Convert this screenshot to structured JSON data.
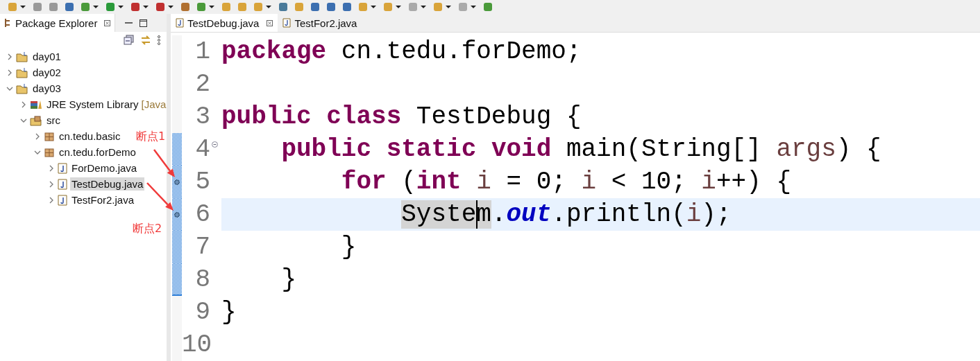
{
  "explorer": {
    "title": "Package Explorer",
    "tree": [
      {
        "label": "day01",
        "kind": "project",
        "expanded": false,
        "selected": false
      },
      {
        "label": "day02",
        "kind": "project",
        "expanded": false,
        "selected": false
      },
      {
        "label": "day03",
        "kind": "project",
        "expanded": true,
        "selected": false,
        "children": [
          {
            "label": "JRE System Library",
            "decoration": "[Java",
            "kind": "library",
            "expanded": false,
            "selected": false
          },
          {
            "label": "src",
            "kind": "source",
            "expanded": true,
            "selected": false,
            "children": [
              {
                "label": "cn.tedu.basic",
                "kind": "package",
                "expanded": false,
                "selected": false
              },
              {
                "label": "cn.tedu.forDemo",
                "kind": "package",
                "expanded": true,
                "selected": false,
                "children": [
                  {
                    "label": "ForDemo.java",
                    "kind": "file",
                    "expanded": false,
                    "selected": false
                  },
                  {
                    "label": "TestDebug.java",
                    "kind": "file",
                    "expanded": false,
                    "selected": true
                  },
                  {
                    "label": "TestFor2.java",
                    "kind": "file",
                    "expanded": false,
                    "selected": false
                  }
                ]
              }
            ]
          }
        ]
      }
    ]
  },
  "editor": {
    "tabs": [
      {
        "label": "TestDebug.java",
        "selected": true
      },
      {
        "label": "TestFor2.java",
        "selected": false
      }
    ],
    "lines": [
      {
        "number": "1",
        "tokens": [
          {
            "text": "package",
            "kind": "keyword"
          },
          {
            "text": " cn.tedu.forDemo;",
            "kind": "plain"
          }
        ]
      },
      {
        "number": "2"
      },
      {
        "number": "3",
        "tokens": [
          {
            "text": "public",
            "kind": "keyword"
          },
          {
            "text": " class",
            "kind": "keyword"
          },
          {
            "text": " TestDebug {",
            "kind": "plain"
          }
        ]
      },
      {
        "number": "4",
        "range": true,
        "foldable": true,
        "tokens": [
          {
            "text": "    public",
            "kind": "keyword"
          },
          {
            "text": " static",
            "kind": "keyword"
          },
          {
            "text": " void",
            "kind": "keyword"
          },
          {
            "text": " main(String[] ",
            "kind": "plain"
          },
          {
            "text": "args",
            "kind": "variable"
          },
          {
            "text": ") {",
            "kind": "plain"
          }
        ]
      },
      {
        "number": "5",
        "range": true,
        "breakpoint": true,
        "tokens": [
          {
            "text": "        for",
            "kind": "keyword"
          },
          {
            "text": " (",
            "kind": "plain"
          },
          {
            "text": "int",
            "kind": "keyword"
          },
          {
            "text": " i",
            "kind": "variable"
          },
          {
            "text": " = 0; ",
            "kind": "plain"
          },
          {
            "text": "i",
            "kind": "variable"
          },
          {
            "text": " < 10; ",
            "kind": "plain"
          },
          {
            "text": "i",
            "kind": "variable"
          },
          {
            "text": "++) {",
            "kind": "plain"
          }
        ]
      },
      {
        "number": "6",
        "range": true,
        "breakpoint": true,
        "current": true,
        "tokens": [
          {
            "text": "            Syste",
            "kind": "plain",
            "marked": true
          },
          {
            "text": "m",
            "kind": "plain",
            "marked": true,
            "caret_before": true
          },
          {
            "text": ".",
            "kind": "plain"
          },
          {
            "text": "out",
            "kind": "field"
          },
          {
            "text": ".println(",
            "kind": "plain"
          },
          {
            "text": "i",
            "kind": "variable"
          },
          {
            "text": ");",
            "kind": "plain"
          }
        ]
      },
      {
        "number": "7",
        "range": true,
        "tokens": [
          {
            "text": "        }",
            "kind": "plain"
          }
        ]
      },
      {
        "number": "8",
        "range": true,
        "tokens": [
          {
            "text": "    }",
            "kind": "plain"
          }
        ]
      },
      {
        "number": "9",
        "tokens": [
          {
            "text": "}",
            "kind": "plain"
          }
        ]
      },
      {
        "number": "10"
      }
    ]
  },
  "annotations": [
    {
      "text": "断点1"
    },
    {
      "text": "断点2"
    }
  ]
}
